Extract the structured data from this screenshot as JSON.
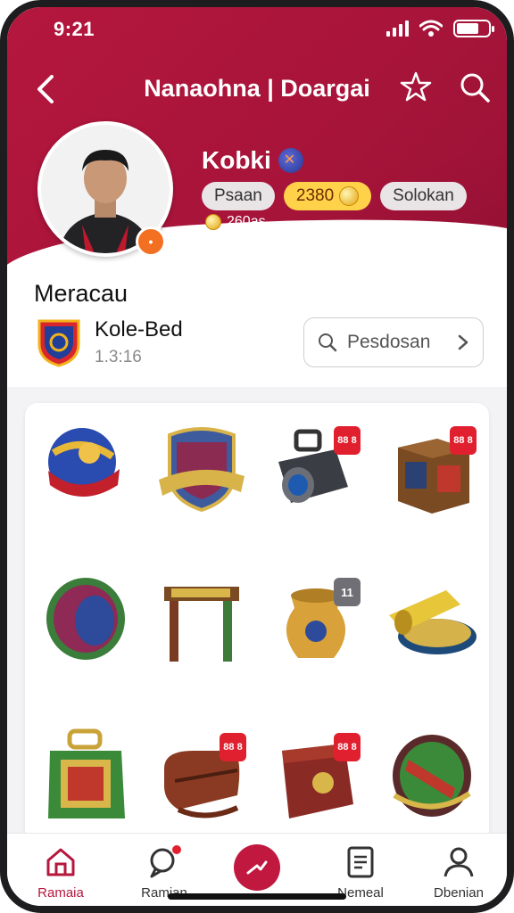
{
  "status": {
    "time": "9:21"
  },
  "nav": {
    "title": "Nanaohna | Doargai"
  },
  "profile": {
    "name": "Kobki",
    "pills": [
      "Psaan",
      "2380",
      "Solokan"
    ],
    "coins": "260as"
  },
  "section": {
    "title": "Meracau",
    "club_name": "Kole-Bed",
    "club_number": "1.3:16",
    "search_label": "Pesdosan"
  },
  "items": [
    {
      "icon": "globe-ball-icon",
      "tag": ""
    },
    {
      "icon": "shield-banner-icon",
      "tag": ""
    },
    {
      "icon": "camera-icon",
      "tag": "88 8"
    },
    {
      "icon": "box-icon",
      "tag": "88 8"
    },
    {
      "icon": "drum-icon",
      "tag": ""
    },
    {
      "icon": "gate-icon",
      "tag": ""
    },
    {
      "icon": "pot-icon",
      "tag": "11"
    },
    {
      "icon": "coin-stack-icon",
      "tag": ""
    },
    {
      "icon": "green-bag-icon",
      "tag": ""
    },
    {
      "icon": "leather-bag-icon",
      "tag": "88 8"
    },
    {
      "icon": "trunk-icon",
      "tag": "88 8"
    },
    {
      "icon": "badge-icon",
      "tag": ""
    }
  ],
  "tabs": [
    {
      "label": "Ramaia",
      "icon": "home-icon"
    },
    {
      "label": "Ramian",
      "icon": "chat-icon"
    },
    {
      "label": "",
      "icon": "play-icon"
    },
    {
      "label": "Nemeal",
      "icon": "document-icon"
    },
    {
      "label": "Dbenian",
      "icon": "profile-icon"
    }
  ],
  "colors": {
    "accent": "#b5173d",
    "tag": "#e0202f",
    "gold": "#ffd24a"
  }
}
